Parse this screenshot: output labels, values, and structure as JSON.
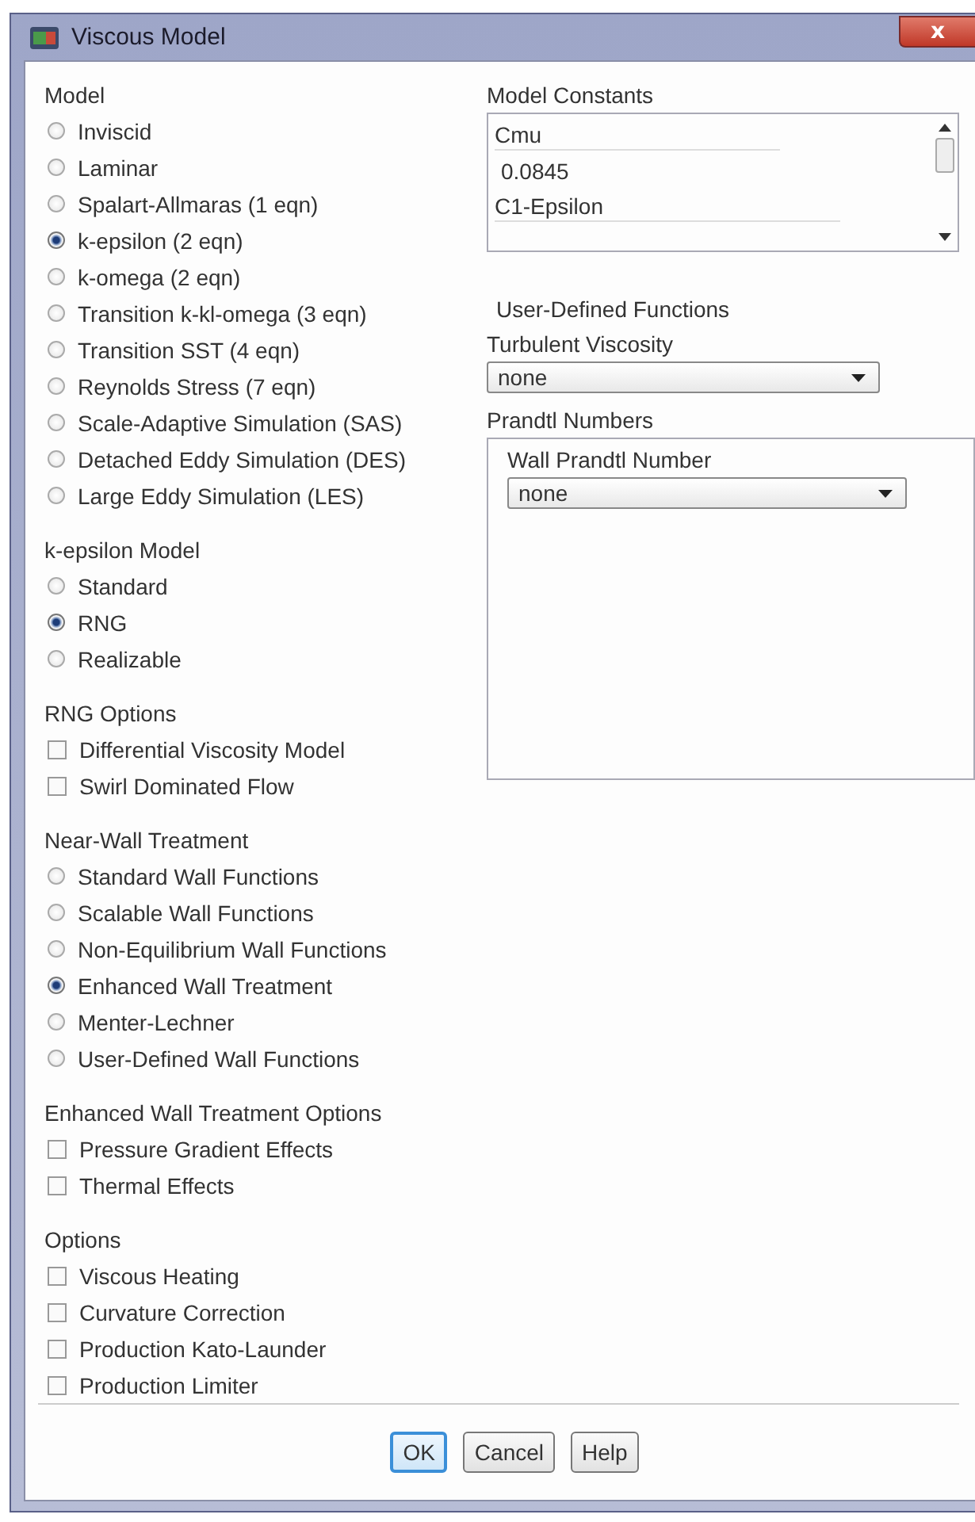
{
  "window": {
    "title": "Viscous Model",
    "close_label": "x"
  },
  "left_sections": [
    {
      "title": "Model",
      "kind": "radio",
      "options": [
        {
          "label": "Inviscid",
          "selected": false
        },
        {
          "label": "Laminar",
          "selected": false
        },
        {
          "label": "Spalart-Allmaras (1 eqn)",
          "selected": false
        },
        {
          "label": "k-epsilon (2 eqn)",
          "selected": true
        },
        {
          "label": "k-omega (2 eqn)",
          "selected": false
        },
        {
          "label": "Transition k-kl-omega (3 eqn)",
          "selected": false
        },
        {
          "label": "Transition SST (4 eqn)",
          "selected": false
        },
        {
          "label": "Reynolds Stress (7 eqn)",
          "selected": false
        },
        {
          "label": "Scale-Adaptive Simulation (SAS)",
          "selected": false
        },
        {
          "label": "Detached Eddy Simulation (DES)",
          "selected": false
        },
        {
          "label": "Large Eddy Simulation (LES)",
          "selected": false
        }
      ]
    },
    {
      "title": "k-epsilon Model",
      "kind": "radio",
      "options": [
        {
          "label": "Standard",
          "selected": false
        },
        {
          "label": "RNG",
          "selected": true
        },
        {
          "label": "Realizable",
          "selected": false
        }
      ]
    },
    {
      "title": "RNG Options",
      "kind": "checkbox",
      "options": [
        {
          "label": "Differential Viscosity Model",
          "checked": false
        },
        {
          "label": "Swirl Dominated Flow",
          "checked": false
        }
      ]
    },
    {
      "title": "Near-Wall Treatment",
      "kind": "radio",
      "options": [
        {
          "label": "Standard Wall Functions",
          "selected": false
        },
        {
          "label": "Scalable Wall Functions",
          "selected": false
        },
        {
          "label": "Non-Equilibrium Wall Functions",
          "selected": false
        },
        {
          "label": "Enhanced Wall Treatment",
          "selected": true
        },
        {
          "label": "Menter-Lechner",
          "selected": false
        },
        {
          "label": "User-Defined Wall Functions",
          "selected": false
        }
      ]
    },
    {
      "title": "Enhanced Wall Treatment Options",
      "kind": "checkbox",
      "options": [
        {
          "label": "Pressure Gradient Effects",
          "checked": false
        },
        {
          "label": "Thermal Effects",
          "checked": false
        }
      ]
    },
    {
      "title": "Options",
      "kind": "checkbox",
      "options": [
        {
          "label": "Viscous Heating",
          "checked": false
        },
        {
          "label": "Curvature Correction",
          "checked": false
        },
        {
          "label": "Production Kato-Launder",
          "checked": false
        },
        {
          "label": "Production Limiter",
          "checked": false
        }
      ]
    }
  ],
  "model_constants": {
    "title": "Model Constants",
    "items": [
      {
        "name": "Cmu",
        "value": "0.0845"
      },
      {
        "name": "C1-Epsilon"
      }
    ]
  },
  "user_defined_functions": {
    "title": "User-Defined Functions",
    "turbulent_viscosity": {
      "label": "Turbulent Viscosity",
      "value": "none"
    }
  },
  "prandtl_numbers": {
    "title": "Prandtl Numbers",
    "wall_prandtl_number": {
      "label": "Wall Prandtl Number",
      "value": "none"
    }
  },
  "buttons": [
    {
      "label": "OK",
      "default": true
    },
    {
      "label": "Cancel",
      "default": false
    },
    {
      "label": "Help",
      "default": false
    }
  ]
}
